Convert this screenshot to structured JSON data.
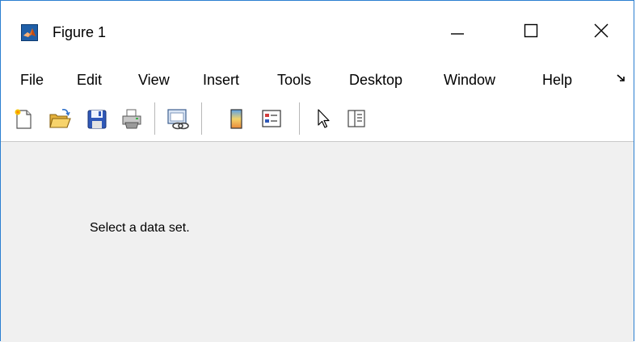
{
  "window": {
    "title": "Figure 1",
    "app_icon": "matlab-logo-icon",
    "controls": [
      "minimize-icon",
      "maximize-icon",
      "close-icon"
    ]
  },
  "menu": {
    "items": [
      "File",
      "Edit",
      "View",
      "Insert",
      "Tools",
      "Desktop",
      "Window",
      "Help"
    ],
    "overflow_icon": "menu-overflow-arrow-icon"
  },
  "toolbar": {
    "buttons": [
      "new-figure-icon",
      "open-file-icon",
      "save-figure-icon",
      "print-figure-icon",
      "link-plot-icon",
      "insert-colorbar-icon",
      "insert-legend-icon",
      "edit-plot-icon",
      "open-property-inspector-icon"
    ]
  },
  "content": {
    "message": "Select a data set."
  },
  "colors": {
    "border": "#2b7fd1",
    "chrome_bg": "#ffffff",
    "figure_bg": "#f0f0f0"
  }
}
